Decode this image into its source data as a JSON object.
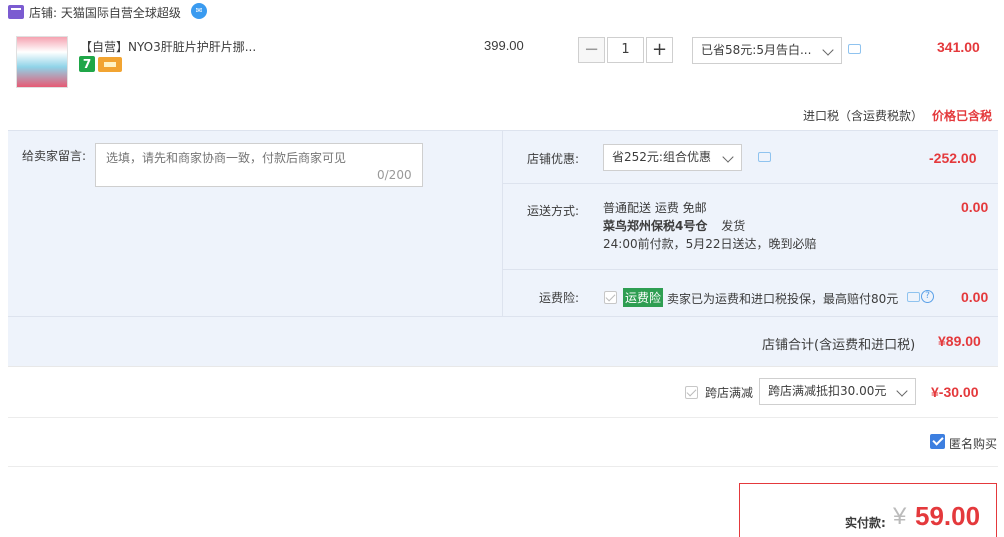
{
  "shop": {
    "label": "店铺: 天猫国际自营全球超级"
  },
  "item": {
    "name": "【自营】NYO3肝脏片护肝片挪...",
    "badge_text": "7",
    "unit_price": "399.00",
    "quantity": "1",
    "promo_selected": "已省58元:5月告白...",
    "total": "341.00",
    "tax_note": "进口税（含运费税款）",
    "tax_status": "价格已含税"
  },
  "message": {
    "label": "给卖家留言:",
    "placeholder": "选填，请先和商家协商一致，付款后商家可见",
    "count": "0/200"
  },
  "store_discount": {
    "label": "店铺优惠:",
    "selected": "省252元:组合优惠",
    "amount": "-252.00"
  },
  "shipping": {
    "label": "运送方式:",
    "line1": "普通配送 运费 免邮",
    "warehouse": "菜鸟郑州保税4号仓",
    "dispatch": "发货",
    "line3": "24:00前付款，5月22日送达，晚到必赔",
    "amount": "0.00"
  },
  "insurance": {
    "label": "运费险:",
    "tag": "运费险",
    "text": "卖家已为运费和进口税投保，最高赔付80元",
    "amount": "0.00"
  },
  "shop_total": {
    "label": "店铺合计(含运费和进口税)",
    "value": "¥89.00"
  },
  "cross_store": {
    "label": "跨店满减",
    "selected": "跨店满减抵扣30.00元",
    "value": "¥-30.00"
  },
  "anonymous": {
    "label": "匿名购买"
  },
  "payment": {
    "label": "实付款:",
    "currency": "¥",
    "amount": "59.00"
  },
  "colors": {
    "accent_red": "#e4393c",
    "section_blue": "#eef3fb",
    "insurance_green": "#2e9e52"
  },
  "icons": [
    "shop-icon",
    "wangwang-icon",
    "chat-icon",
    "help-icon",
    "chevron-down-icon"
  ]
}
